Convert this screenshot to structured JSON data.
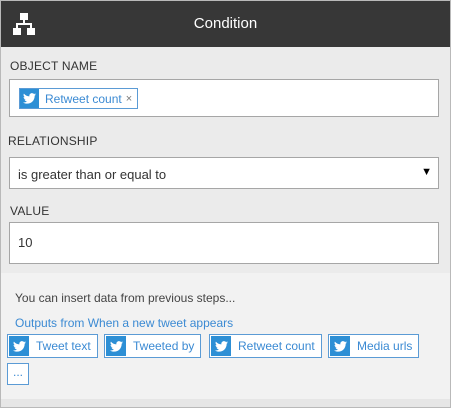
{
  "header": {
    "title": "Condition",
    "icon": "flow-diagram-icon"
  },
  "object_name": {
    "label": "OBJECT NAME",
    "token": {
      "icon": "twitter-bird-icon",
      "text": "Retweet count",
      "remove": "×"
    }
  },
  "relationship": {
    "label": "RELATIONSHIP",
    "selected": "is greater than or equal to",
    "arrow": "▼"
  },
  "value": {
    "label": "VALUE",
    "text": "10"
  },
  "insert_panel": {
    "hint": "You can insert data from previous steps...",
    "outputs_link": "Outputs from When a new tweet appears",
    "outputs": [
      {
        "icon": "twitter-bird-icon",
        "label": "Tweet text"
      },
      {
        "icon": "twitter-bird-icon",
        "label": "Tweeted by"
      },
      {
        "icon": "twitter-bird-icon",
        "label": "Retweet count"
      },
      {
        "icon": "twitter-bird-icon",
        "label": "Media urls"
      }
    ],
    "more": "..."
  },
  "colors": {
    "titlebar": "#373737",
    "accent": "#3b8ad3",
    "twitter": "#2d8fd5",
    "panel": "#ebebeb"
  }
}
